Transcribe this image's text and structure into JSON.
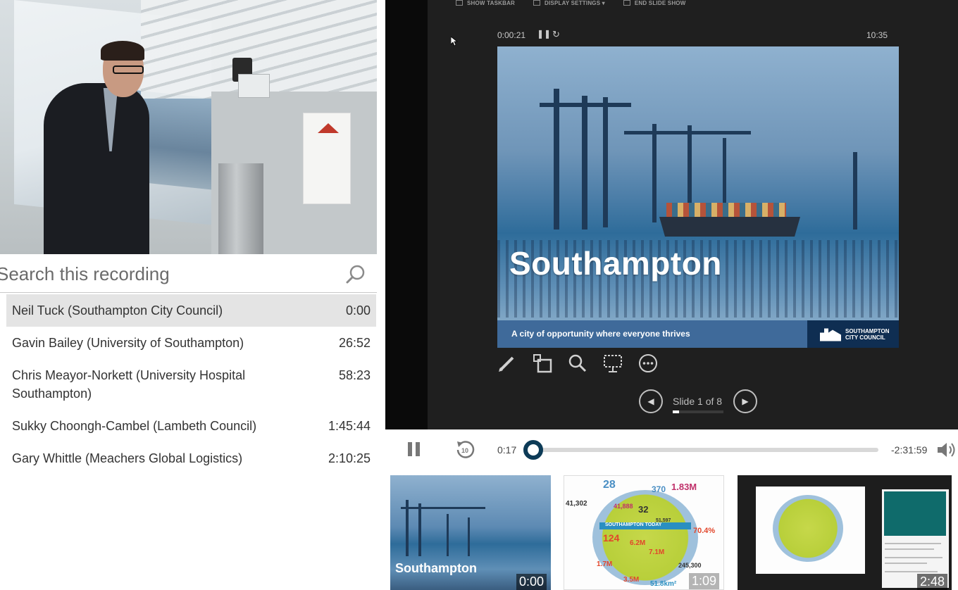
{
  "camera": {
    "alt": "Speaker presenting at podium"
  },
  "search": {
    "placeholder": "Search this recording"
  },
  "index": [
    {
      "title": "Neil Tuck (Southampton City Council)",
      "time": "0:00",
      "active": true
    },
    {
      "title": "Gavin Bailey (University of Southampton)",
      "time": "26:52",
      "active": false
    },
    {
      "title": "Chris Meayor-Norkett (University Hospital Southampton)",
      "time": "58:23",
      "active": false
    },
    {
      "title": "Sukky Choongh-Cambel (Lambeth Council)",
      "time": "1:45:44",
      "active": false
    },
    {
      "title": "Gary Whittle (Meachers Global Logistics)",
      "time": "2:10:25",
      "active": false
    }
  ],
  "presenter": {
    "toolbar": [
      "SHOW TASKBAR",
      "DISPLAY SETTINGS ▾",
      "END SLIDE SHOW"
    ],
    "elapsed": "0:00:21",
    "clock": "10:35",
    "slide_title": "Southampton",
    "slide_tagline": "A city of opportunity where everyone thrives",
    "council_line1": "SOUTHAMPTON",
    "council_line2": "CITY COUNCIL",
    "slide_counter": "Slide 1 of 8",
    "slide_progress": 0.125,
    "tools": [
      "pen-icon",
      "slides-grid-icon",
      "zoom-icon",
      "screen-icon",
      "more-icon"
    ]
  },
  "player": {
    "current_time": "0:17",
    "remaining_time": "-2:31:59",
    "progress": 0.0
  },
  "thumbnails": [
    {
      "title": "Southampton",
      "time": "0:00"
    },
    {
      "title": "",
      "time": "1:09",
      "stats": [
        "28",
        "370",
        "1.83M",
        "41,302",
        "41,888",
        "32",
        "124",
        "6.2M",
        "7.1M",
        "70.4%",
        "1.7M",
        "3.5M",
        "51.8km²",
        "245,300",
        "51,597"
      ],
      "band": "SOUTHAMPTON TODAY"
    },
    {
      "title": "",
      "time": "2:48"
    }
  ],
  "colors": {
    "accent": "#0d3b57",
    "slide_band": "#3f6a9a",
    "council_band": "#0f2e52",
    "active_row": "#e4e4e4"
  }
}
